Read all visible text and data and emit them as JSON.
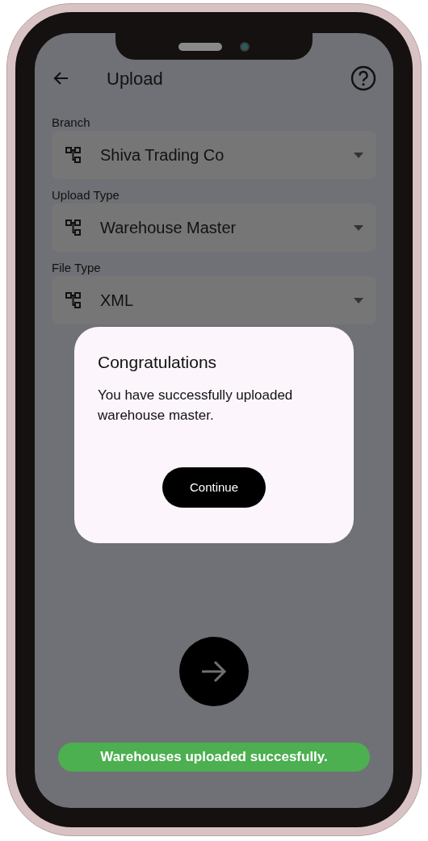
{
  "header": {
    "title": "Upload"
  },
  "fields": [
    {
      "label": "Branch",
      "value": "Shiva Trading Co"
    },
    {
      "label": "Upload Type",
      "value": "Warehouse Master"
    },
    {
      "label": "File Type",
      "value": "XML"
    }
  ],
  "dialog": {
    "title": "Congratulations",
    "message": "You have successfully uploaded warehouse master.",
    "button": "Continue"
  },
  "snackbar": {
    "text": "Warehouses uploaded succesfully."
  }
}
